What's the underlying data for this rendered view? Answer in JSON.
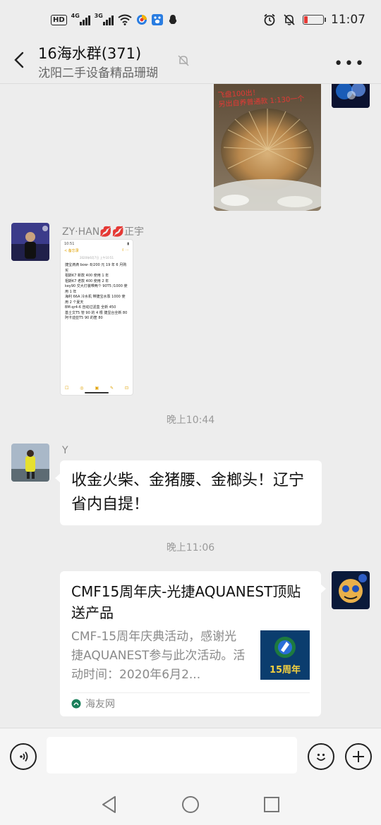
{
  "status_bar": {
    "time": "11:07",
    "hd": "HD",
    "net1": "4G",
    "net2": "3G"
  },
  "header": {
    "title": "16海水群(371)",
    "subtitle": "沈阳二手设备精品珊瑚"
  },
  "photo_caption": "飞盘100出！\n另出自养普通款 1:130一个",
  "messages": [
    {
      "sender": "ZY·HAN💋💋正宇",
      "screenshot_note": {
        "status_time": "10:51",
        "back_label": "< 备忘录",
        "date": "2020年6月7日 上午10:51",
        "text": "捷宝滴滴 bow- 8/200 元 19 年 6 月购买\n祖斯K7 新款 400 使用 1 年\n祖斯K7 老款 400 使用 2 年\nkey90 交大灯装带两个 90T5 /1000 使用 1 年\n海利 66A 冷水机 带捷宝水泵 1000 使用 2 个夏天\nBM-qr4-6 自动过滤盒 全新 450\n基士文T5 管 90 的 4 根 捷显台全新 80\n阿卡迪亚T5 90 的筐 80"
      }
    }
  ],
  "time1": "晚上10:44",
  "msg_y": {
    "sender": "Y",
    "text": "收金火柴、金猪腰、金榔头！辽宁省内自提！"
  },
  "time2": "晚上11:06",
  "link_card": {
    "title": "CMF15周年庆-光捷AQUANEST顶贴送产品",
    "description": "CMF-15周年庆典活动，感谢光捷AQUANEST参与此次活动。活动时间：2020年6月2...",
    "thumb_text": "15周年",
    "source": "海友网"
  },
  "colors": {
    "bg": "#ededed",
    "bubble": "#ffffff",
    "accent_source": "#1a7f5a"
  }
}
